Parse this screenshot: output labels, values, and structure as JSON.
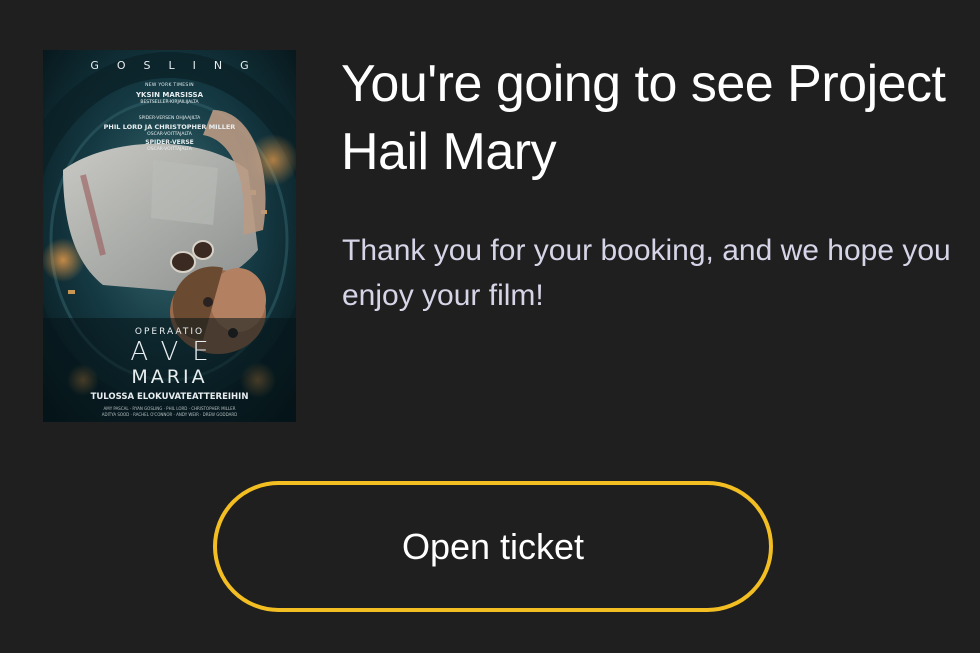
{
  "poster": {
    "top_name": "GOSLING",
    "tagline_small": "NEW YORK TIMESIN",
    "tagline_title": "YKSIN MARSISSA",
    "tagline_sub": "BESTSELLER-KIRJAILIJALTA",
    "from_line": "SPIDER-VERSEN OHJAAJILTA",
    "directors": "PHIL LORD JA CHRISTOPHER MILLER",
    "oscar_line": "OSCAR-VOITTAJALTA",
    "spider_verse": "SPIDER-VERSE",
    "oscar_line_2": "OSCAR-VOITTAJALTA",
    "operaatio": "OPERAATIO",
    "title_line1": "AVE",
    "title_line2": "MARIA",
    "release": "TULOSSA ELOKUVATEATTEREIHIN",
    "credits_1": "AMY PASCAL · RYAN GOSLING · PHIL LORD · CHRISTOPHER MILLER",
    "credits_2": "ADITYA SOOD · RACHEL O'CONNOR · ANDY WEIR · DREW GODDARD"
  },
  "confirmation": {
    "headline": "You're going to see Project Hail Mary",
    "message": "Thank you for your booking, and we hope you enjoy your film!"
  },
  "actions": {
    "open_ticket_label": "Open ticket"
  },
  "colors": {
    "background": "#1f1f1f",
    "accent_border": "#f2be22",
    "subtext": "#d6d5e8",
    "text": "#ffffff"
  }
}
